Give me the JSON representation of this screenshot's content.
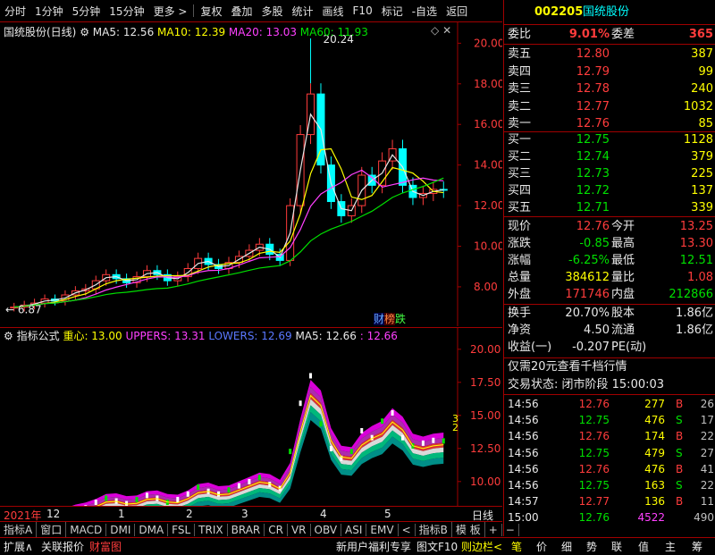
{
  "toolbar": {
    "items": [
      "分时",
      "1分钟",
      "5分钟",
      "15分钟",
      "更多 >",
      "复权",
      "叠加",
      "多股",
      "统计",
      "画线",
      "F10",
      "标记",
      "-自选",
      "返回"
    ]
  },
  "main_chart": {
    "title": "国统股份(日线)",
    "ma5": "MA5: 12.56",
    "ma10": "MA10: 12.39",
    "ma20": "MA20: 13.03",
    "ma60": "MA60: 11.93",
    "high_label": "20.24",
    "low_label": "6.87",
    "badges": [
      "财",
      "榜",
      "跌"
    ]
  },
  "indicator_chart": {
    "title": "指标公式",
    "center": "重心: 13.00",
    "uppers": "UPPERS: 13.31",
    "lowers": "LOWERS: 12.69",
    "ma5": "MA5: 12.66",
    "extra": ": 12.66",
    "right_marks": [
      "3",
      "2"
    ]
  },
  "chart_data": [
    {
      "type": "candlestick",
      "title": "国统股份(日线)",
      "yticks": [
        8.0,
        10.0,
        12.0,
        14.0,
        16.0,
        18.0,
        20.0
      ],
      "ylim": [
        6.5,
        20.5
      ],
      "xlabels": [
        "2021年",
        "12",
        "1",
        "2",
        "3",
        "4",
        "5"
      ],
      "close_approx": [
        7.0,
        7.1,
        7.2,
        7.4,
        7.3,
        7.6,
        7.8,
        7.9,
        8.3,
        8.6,
        8.4,
        8.2,
        8.5,
        8.8,
        8.6,
        8.3,
        8.5,
        8.9,
        9.4,
        9.1,
        8.9,
        9.2,
        9.5,
        9.8,
        10.1,
        9.6,
        9.3,
        12.0,
        15.5,
        17.5,
        14.0,
        12.2,
        11.5,
        12.0,
        13.5,
        13.0,
        14.2,
        14.8,
        13.0,
        12.4,
        12.6,
        12.8,
        12.76
      ],
      "ma_series": [
        "MA5",
        "MA10",
        "MA20",
        "MA60"
      ],
      "extremes": {
        "high": 20.24,
        "low": 6.87
      }
    },
    {
      "type": "area",
      "title": "指标公式",
      "yticks": [
        10.0,
        12.5,
        15.0,
        17.5,
        20.0
      ],
      "ylim": [
        8.5,
        21
      ],
      "series": [
        {
          "name": "重心",
          "last": 13.0
        },
        {
          "name": "UPPERS",
          "last": 13.31
        },
        {
          "name": "LOWERS",
          "last": 12.69
        },
        {
          "name": "MA5",
          "last": 12.66
        }
      ]
    }
  ],
  "axis_tabs": {
    "x_labels": [
      "2021年",
      "12",
      "1",
      "2",
      "3",
      "4",
      "5"
    ],
    "day_label": "日线"
  },
  "indicator_tabs": [
    "指标A",
    "窗口",
    "MACD",
    "DMI",
    "DMA",
    "FSL",
    "TRIX",
    "BRAR",
    "CR",
    "VR",
    "OBV",
    "ASI",
    "EMV",
    "<",
    "指标B",
    "模 板",
    "+",
    "−"
  ],
  "status": {
    "left": [
      "扩展∧",
      "关联报价",
      "财富图"
    ],
    "middle": [
      "新用户福利专享",
      "图文F10",
      "则边栏<"
    ],
    "right_tabs": [
      "笔",
      "价",
      "细",
      "势",
      "联",
      "值",
      "主",
      "筹"
    ]
  },
  "quote": {
    "code": "002205",
    "name": "国统股份",
    "weibi_label": "委比",
    "weibi": "9.01%",
    "weicha_label": "委差",
    "weicha": "365",
    "asks": [
      {
        "label": "卖五",
        "price": "12.80",
        "vol": "387"
      },
      {
        "label": "卖四",
        "price": "12.79",
        "vol": "99"
      },
      {
        "label": "卖三",
        "price": "12.78",
        "vol": "240"
      },
      {
        "label": "卖二",
        "price": "12.77",
        "vol": "1032"
      },
      {
        "label": "卖一",
        "price": "12.76",
        "vol": "85"
      }
    ],
    "bids": [
      {
        "label": "买一",
        "price": "12.75",
        "vol": "1128"
      },
      {
        "label": "买二",
        "price": "12.74",
        "vol": "379"
      },
      {
        "label": "买三",
        "price": "12.73",
        "vol": "225"
      },
      {
        "label": "买四",
        "price": "12.72",
        "vol": "137"
      },
      {
        "label": "买五",
        "price": "12.71",
        "vol": "339"
      }
    ],
    "stats": [
      {
        "l1": "现价",
        "v1": "12.76",
        "l2": "今开",
        "v2": "13.25",
        "c1": "red",
        "c2": "red"
      },
      {
        "l1": "涨跌",
        "v1": "-0.85",
        "l2": "最高",
        "v2": "13.30",
        "c1": "grn",
        "c2": "red"
      },
      {
        "l1": "涨幅",
        "v1": "-6.25%",
        "l2": "最低",
        "v2": "12.51",
        "c1": "grn",
        "c2": "grn"
      },
      {
        "l1": "总量",
        "v1": "384612",
        "l2": "量比",
        "v2": "1.08",
        "c1": "yel",
        "c2": "red"
      },
      {
        "l1": "外盘",
        "v1": "171746",
        "l2": "内盘",
        "v2": "212866",
        "c1": "red",
        "c2": "grn"
      }
    ],
    "stats2": [
      {
        "l1": "换手",
        "v1": "20.70%",
        "l2": "股本",
        "v2": "1.86亿"
      },
      {
        "l1": "净资",
        "v1": "4.50",
        "l2": "流通",
        "v2": "1.86亿"
      },
      {
        "l1": "收益(一)",
        "v1": "-0.207",
        "l2": "PE(动)",
        "v2": ""
      }
    ],
    "promo": "仅需20元查看千档行情",
    "trade_status": "交易状态: 闭市阶段 15:00:03",
    "ticks": [
      {
        "t": "14:56",
        "p": "12.76",
        "v": "277",
        "bs": "B",
        "n": "26"
      },
      {
        "t": "14:56",
        "p": "12.75",
        "v": "476",
        "bs": "S",
        "n": "17"
      },
      {
        "t": "14:56",
        "p": "12.76",
        "v": "174",
        "bs": "B",
        "n": "22"
      },
      {
        "t": "14:56",
        "p": "12.75",
        "v": "479",
        "bs": "S",
        "n": "27"
      },
      {
        "t": "14:56",
        "p": "12.76",
        "v": "476",
        "bs": "B",
        "n": "41"
      },
      {
        "t": "14:56",
        "p": "12.75",
        "v": "163",
        "bs": "S",
        "n": "22"
      },
      {
        "t": "14:57",
        "p": "12.77",
        "v": "136",
        "bs": "B",
        "n": "11"
      },
      {
        "t": "15:00",
        "p": "12.76",
        "v": "4522",
        "bs": "",
        "n": "490"
      }
    ]
  }
}
